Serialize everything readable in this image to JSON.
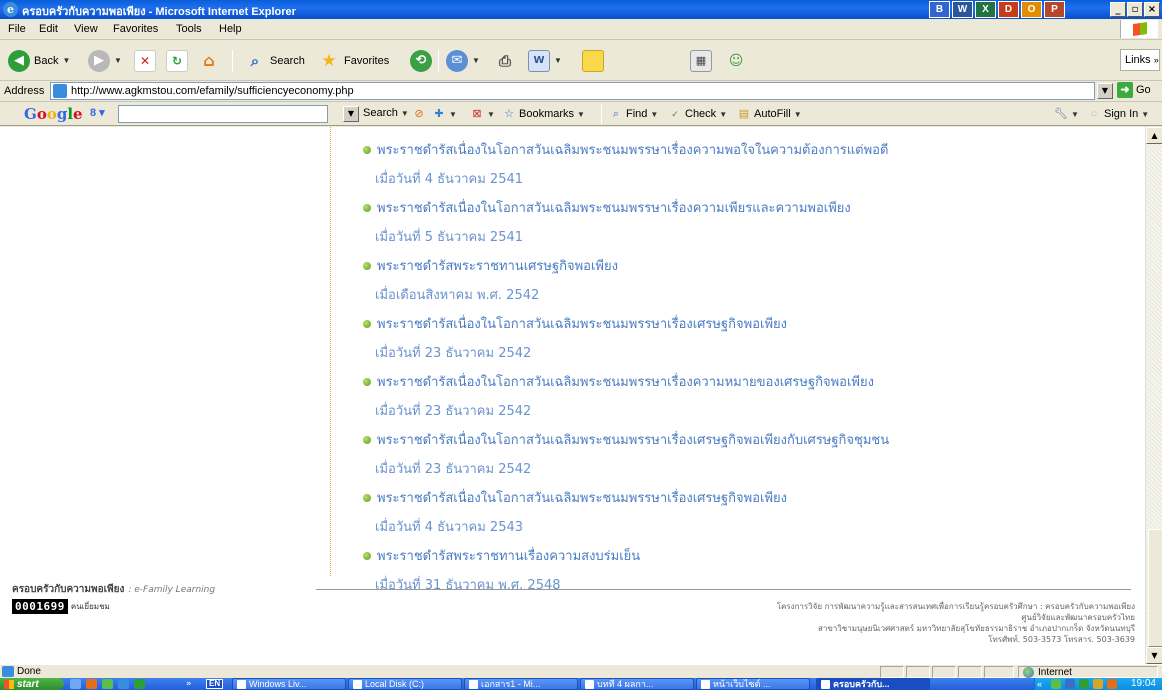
{
  "window": {
    "title": "ครอบครัวกับความพอเพียง - Microsoft Internet Explorer",
    "app_buttons": [
      "B",
      "W",
      "X",
      "D",
      "O",
      "P"
    ],
    "controls": [
      "_",
      "▫",
      "×"
    ]
  },
  "menu": [
    "File",
    "Edit",
    "View",
    "Favorites",
    "Tools",
    "Help"
  ],
  "toolbar": {
    "back": "Back",
    "search": "Search",
    "favorites": "Favorites",
    "links": "Links"
  },
  "address": {
    "label": "Address",
    "url": "http://www.agkmstou.com/efamily/sufficiencyeconomy.php",
    "go": "Go"
  },
  "googlebar": {
    "logo": "Google",
    "search": "Search",
    "bookmarks": "Bookmarks",
    "find": "Find",
    "check": "Check",
    "autofill": "AutoFill",
    "sign_in": "Sign In"
  },
  "content": {
    "items": [
      {
        "link": "พระราชดำรัสเนื่องในโอกาสวันเฉลิมพระชนมพรรษาเรื่องความพอใจในความต้องการแต่พอดี",
        "date": "เมื่อวันที่ 4 ธันวาคม 2541"
      },
      {
        "link": "พระราชดำรัสเนื่องในโอกาสวันเฉลิมพระชนมพรรษาเรื่องความเพียรและความพอเพียง",
        "date": "เมื่อวันที่ 5 ธันวาคม 2541"
      },
      {
        "link": "พระราชดำรัสพระราชทานเศรษฐกิจพอเพียง",
        "date": "เมื่อเดือนสิงหาคม พ.ศ. 2542"
      },
      {
        "link": "พระราชดำรัสเนื่องในโอกาสวันเฉลิมพระชนมพรรษาเรื่องเศรษฐกิจพอเพียง",
        "date": "เมื่อวันที่ 23 ธันวาคม 2542"
      },
      {
        "link": "พระราชดำรัสเนื่องในโอกาสวันเฉลิมพระชนมพรรษาเรื่องความหมายของเศรษฐกิจพอเพียง",
        "date": "เมื่อวันที่ 23 ธันวาคม 2542"
      },
      {
        "link": "พระราชดำรัสเนื่องในโอกาสวันเฉลิมพระชนมพรรษาเรื่องเศรษฐกิจพอเพียงกับเศรษฐกิจชุมชน",
        "date": "เมื่อวันที่ 23 ธันวาคม 2542"
      },
      {
        "link": "พระราชดำรัสเนื่องในโอกาสวันเฉลิมพระชนมพรรษาเรื่องเศรษฐกิจพอเพียง",
        "date": "เมื่อวันที่ 4 ธันวาคม 2543"
      },
      {
        "link": "พระราชดำรัสพระราชทานเรื่องความสงบร่มเย็น",
        "date": "เมื่อวันที่ 31 ธันวาคม พ.ศ. 2548"
      }
    ],
    "footer": {
      "brand": "ครอบครัวกับความพอเพียง",
      "brand_sub": ": e-Family Learning",
      "counter": "0001699",
      "counter_caption": "คนเยี่ยมชม",
      "org_lines": [
        "โครงการวิจัย การพัฒนาความรู้และสารสนเทศเพื่อการเรียนรู้ครอบครัวศึกษา : ครอบครัวกับความพอเพียง",
        "ศูนย์วิจัยและพัฒนาครอบครัวไทย",
        "สาขาวิชามนุษยนิเวศศาสตร์ มหาวิทยาลัยสุโขทัยธรรมาธิราช อำเภอปากเกร็ด จังหวัดนนทบุรี",
        "โทรศัพท์. 503-3573   โทรสาร. 503-3639"
      ]
    }
  },
  "status": {
    "text": "Done",
    "zone": "Internet"
  },
  "taskbar": {
    "start": "start",
    "lang": "EN",
    "tasks": [
      "Windows Liv...",
      "Local Disk (C:)",
      "เอกสาร1 - Mi...",
      "บทที่ 4 ผลกา...",
      "หน้าเว็บไซต์ ...",
      "ครอบครัวกับ..."
    ],
    "clock": "19:04"
  }
}
